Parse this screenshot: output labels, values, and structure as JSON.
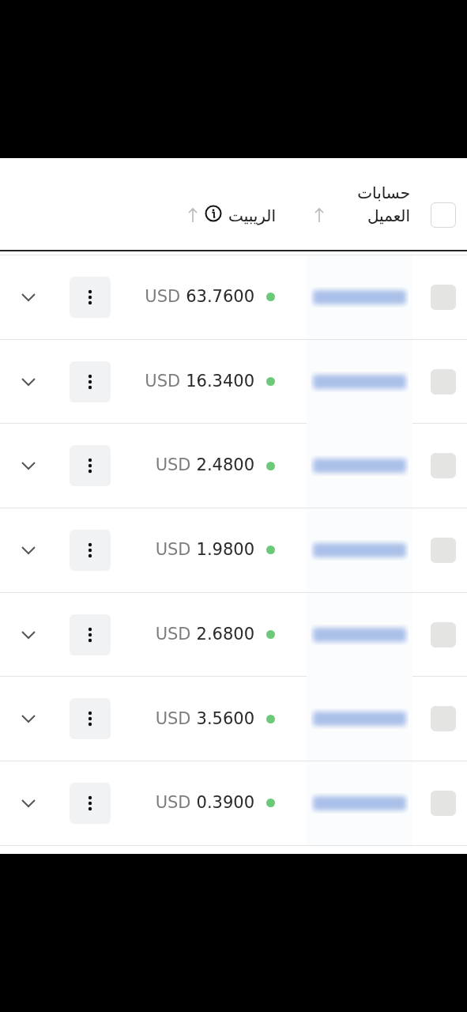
{
  "table": {
    "header": {
      "select_all": {
        "checked": false
      },
      "columns": [
        {
          "label": "حسابات العميل",
          "sortable": true,
          "info": false
        },
        {
          "label": "الريبيت",
          "sortable": true,
          "info": true
        }
      ]
    },
    "rows": [
      {
        "select": {
          "disabled": true
        },
        "color": "#6cc97a",
        "currency": "USD",
        "amount": "63.7600",
        "expanded": false
      },
      {
        "select": {
          "disabled": true
        },
        "color": "#6cc97a",
        "currency": "USD",
        "amount": "16.3400",
        "expanded": false
      },
      {
        "select": {
          "disabled": true
        },
        "color": "#6cc97a",
        "currency": "USD",
        "amount": "2.4800",
        "expanded": false
      },
      {
        "select": {
          "disabled": true
        },
        "color": "#6cc97a",
        "currency": "USD",
        "amount": "1.9800",
        "expanded": false
      },
      {
        "select": {
          "disabled": true
        },
        "color": "#6cc97a",
        "currency": "USD",
        "amount": "2.6800",
        "expanded": false
      },
      {
        "select": {
          "disabled": true
        },
        "color": "#6cc97a",
        "currency": "USD",
        "amount": "3.5600",
        "expanded": false
      },
      {
        "select": {
          "disabled": true
        },
        "color": "#6cc97a",
        "currency": "USD",
        "amount": "0.3900",
        "expanded": false
      }
    ]
  }
}
